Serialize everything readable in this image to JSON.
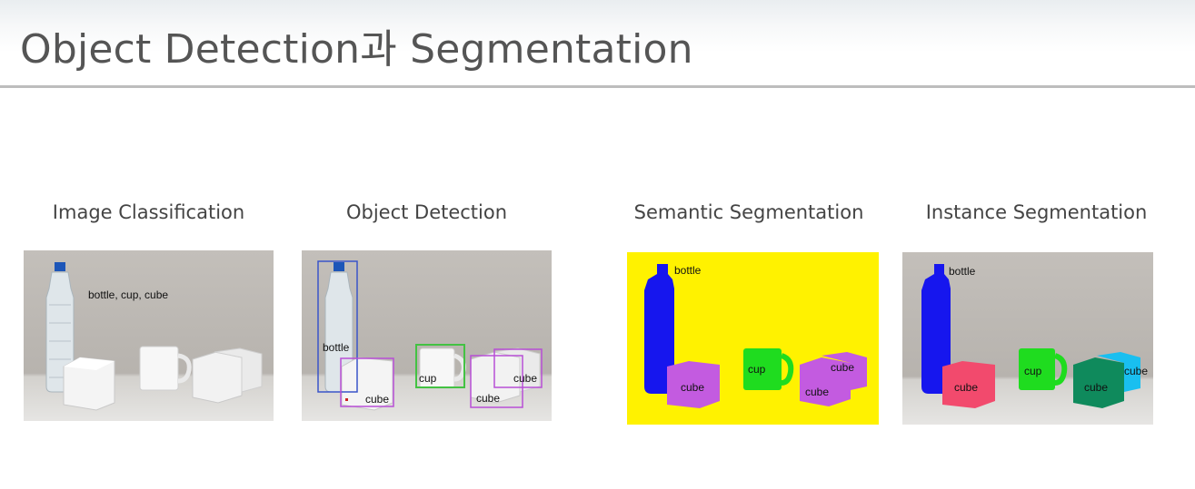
{
  "slide": {
    "title": "Object Detection과 Segmentation"
  },
  "panels": [
    {
      "label": "Image Classification",
      "caption": "bottle, cup, cube"
    },
    {
      "label": "Object Detection",
      "tags": [
        "bottle",
        "cup",
        "cube",
        "cube",
        "cube"
      ]
    },
    {
      "label": "Semantic Segmentation",
      "tags": [
        "bottle",
        "cup",
        "cube",
        "cube",
        "cube"
      ]
    },
    {
      "label": "Instance Segmentation",
      "tags": [
        "bottle",
        "cup",
        "cube",
        "cube",
        "cube"
      ]
    }
  ],
  "colors": {
    "bottle_mask": "#1616ee",
    "cup_mask": "#1fdc1f",
    "semantic_cube": "#c35be0",
    "semantic_background": "#fff200",
    "instance_cube_1": "#f24a6d",
    "instance_cube_2": "#0f8a5c",
    "instance_cube_3": "#19bff0",
    "box_bottle": "#3a55c9",
    "box_cup": "#43c243",
    "box_cube": "#b84fd6"
  }
}
